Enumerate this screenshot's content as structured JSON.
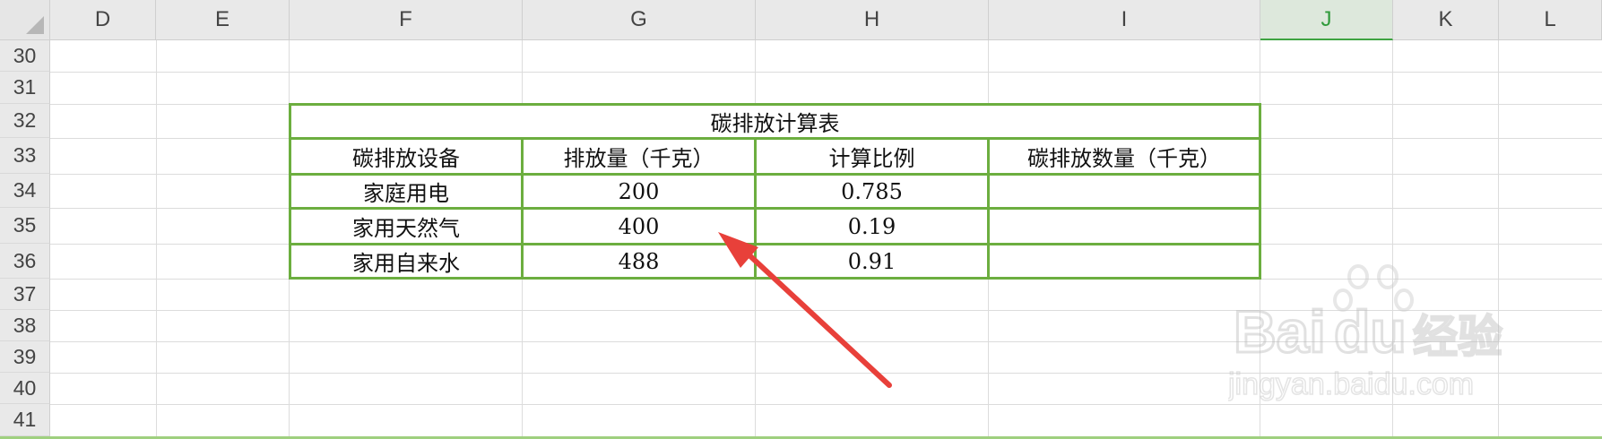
{
  "columns": [
    "D",
    "E",
    "F",
    "G",
    "H",
    "I",
    "J",
    "K",
    "L"
  ],
  "rows": [
    "30",
    "31",
    "32",
    "33",
    "34",
    "35",
    "36",
    "37",
    "38",
    "39",
    "40",
    "41"
  ],
  "selected_column": "J",
  "table": {
    "title": "碳排放计算表",
    "headers": [
      "碳排放设备",
      "排放量（千克）",
      "计算比例",
      "碳排放数量（千克）"
    ],
    "body": [
      [
        "家庭用电",
        "200",
        "0.785",
        ""
      ],
      [
        "家用天然气",
        "400",
        "0.19",
        ""
      ],
      [
        "家用自来水",
        "488",
        "0.91",
        ""
      ]
    ]
  },
  "annotation": {
    "arrow_color": "#e8403a"
  },
  "colors": {
    "table_border": "#6cae3f",
    "selected_header": "#2f9a3a"
  },
  "watermark": {
    "brand": "Bai",
    "brand2": "du",
    "suffix": "经验",
    "url": "jingyan.baidu.com"
  }
}
